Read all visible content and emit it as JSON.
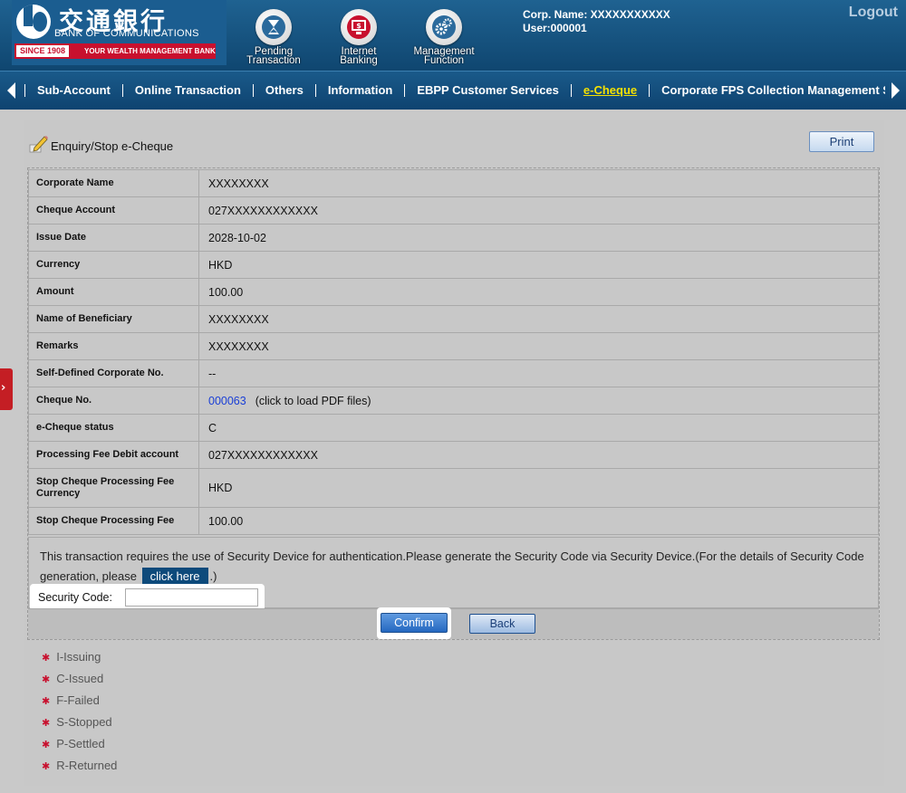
{
  "header": {
    "logo": {
      "cn": "交通銀行",
      "en": "BANK OF COMMUNICATIONS",
      "since": "SINCE 1908",
      "slogan": "YOUR WEALTH MANAGEMENT BANK"
    },
    "icons": [
      {
        "icon": "hourglass-icon",
        "line1": "Pending",
        "line2": "Transaction"
      },
      {
        "icon": "monitor-dollar-icon",
        "line1": "Internet",
        "line2": "Banking"
      },
      {
        "icon": "gears-icon",
        "line1": "Management",
        "line2": "Function"
      }
    ],
    "corp_name": "Corp. Name: XXXXXXXXXXX",
    "user": "User:000001",
    "logout": "Logout"
  },
  "nav": {
    "items": [
      "Sub-Account",
      "Online Transaction",
      "Others",
      "Information",
      "EBPP Customer Services",
      "e-Cheque",
      "Corporate FPS Collection Management Services"
    ],
    "active": "e-Cheque"
  },
  "page": {
    "title": "Enquiry/Stop e-Cheque",
    "print_label": "Print"
  },
  "details": [
    {
      "label": "Corporate Name",
      "value": "XXXXXXXX"
    },
    {
      "label": "Cheque Account",
      "value": "027XXXXXXXXXXXX"
    },
    {
      "label": "Issue Date",
      "value": "2028-10-02"
    },
    {
      "label": "Currency",
      "value": "HKD"
    },
    {
      "label": "Amount",
      "value": "100.00"
    },
    {
      "label": "Name of Beneficiary",
      "value": "XXXXXXXX"
    },
    {
      "label": "Remarks",
      "value": "XXXXXXXX"
    },
    {
      "label": "Self-Defined Corporate No.",
      "value": "--"
    },
    {
      "label": "Cheque No.",
      "value": "000063",
      "note": "(click to load PDF files)"
    },
    {
      "label": "e-Cheque status",
      "value": "C"
    },
    {
      "label": "Processing Fee Debit account",
      "value": "027XXXXXXXXXXXX"
    },
    {
      "label": "Stop Cheque Processing Fee Currency",
      "value": "HKD"
    },
    {
      "label": "Stop Cheque Processing Fee",
      "value": "100.00"
    }
  ],
  "security": {
    "notice_before": "This transaction requires the use of Security Device for authentication.Please generate the Security Code via Security Device.(For the details of Security Code generation, please",
    "click_here": "click here",
    "notice_after": ".)",
    "label": "Security Code:",
    "value": ""
  },
  "buttons": {
    "confirm": "Confirm",
    "back": "Back"
  },
  "legend": [
    "I-Issuing",
    "C-Issued",
    "F-Failed",
    "S-Stopped",
    "P-Settled",
    "R-Returned"
  ]
}
